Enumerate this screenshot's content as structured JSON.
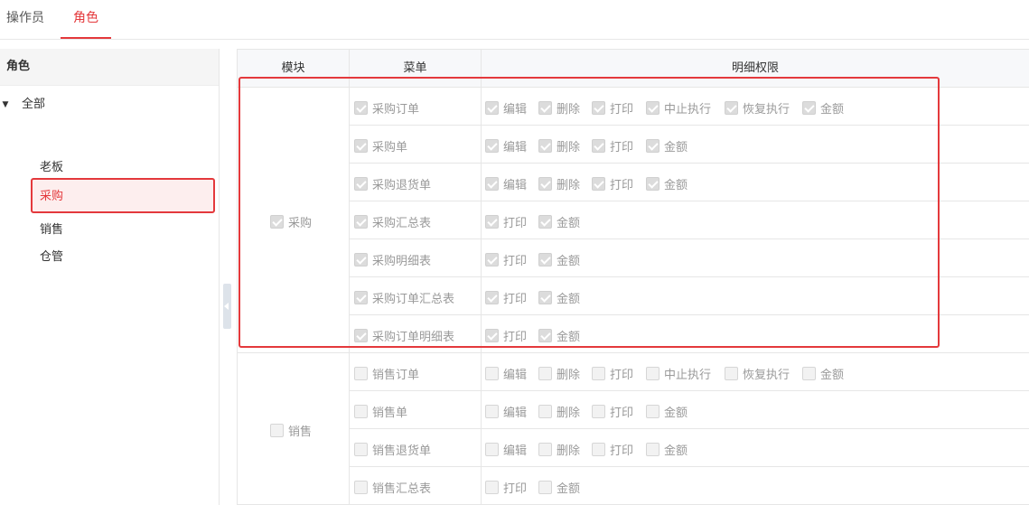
{
  "tabs": [
    {
      "label": "操作员",
      "active": false
    },
    {
      "label": "角色",
      "active": true
    }
  ],
  "left_panel": {
    "title": "角色",
    "root": "全部",
    "roles": [
      "老板",
      "采购",
      "销售",
      "仓管"
    ],
    "selected": "采购"
  },
  "grid": {
    "headers": [
      "模块",
      "菜单",
      "明细权限"
    ],
    "modules": [
      {
        "name": "采购",
        "checked": true,
        "rows": [
          {
            "menu": "采购订单",
            "checked": true,
            "perms": [
              "编辑",
              "删除",
              "打印",
              "中止执行",
              "恢复执行",
              "金额"
            ]
          },
          {
            "menu": "采购单",
            "checked": true,
            "perms": [
              "编辑",
              "删除",
              "打印",
              "金额"
            ]
          },
          {
            "menu": "采购退货单",
            "checked": true,
            "perms": [
              "编辑",
              "删除",
              "打印",
              "金额"
            ]
          },
          {
            "menu": "采购汇总表",
            "checked": true,
            "perms": [
              "打印",
              "金额"
            ]
          },
          {
            "menu": "采购明细表",
            "checked": true,
            "perms": [
              "打印",
              "金额"
            ]
          },
          {
            "menu": "采购订单汇总表",
            "checked": true,
            "perms": [
              "打印",
              "金额"
            ]
          },
          {
            "menu": "采购订单明细表",
            "checked": true,
            "perms": [
              "打印",
              "金额"
            ]
          }
        ]
      },
      {
        "name": "销售",
        "checked": false,
        "rows": [
          {
            "menu": "销售订单",
            "checked": false,
            "perms": [
              "编辑",
              "删除",
              "打印",
              "中止执行",
              "恢复执行",
              "金额"
            ]
          },
          {
            "menu": "销售单",
            "checked": false,
            "perms": [
              "编辑",
              "删除",
              "打印",
              "金额"
            ]
          },
          {
            "menu": "销售退货单",
            "checked": false,
            "perms": [
              "编辑",
              "删除",
              "打印",
              "金额"
            ]
          },
          {
            "menu": "销售汇总表",
            "checked": false,
            "perms": [
              "打印",
              "金额"
            ]
          }
        ]
      }
    ]
  },
  "colors": {
    "accent": "#e4393c",
    "selected_bg": "#fdeeee"
  }
}
